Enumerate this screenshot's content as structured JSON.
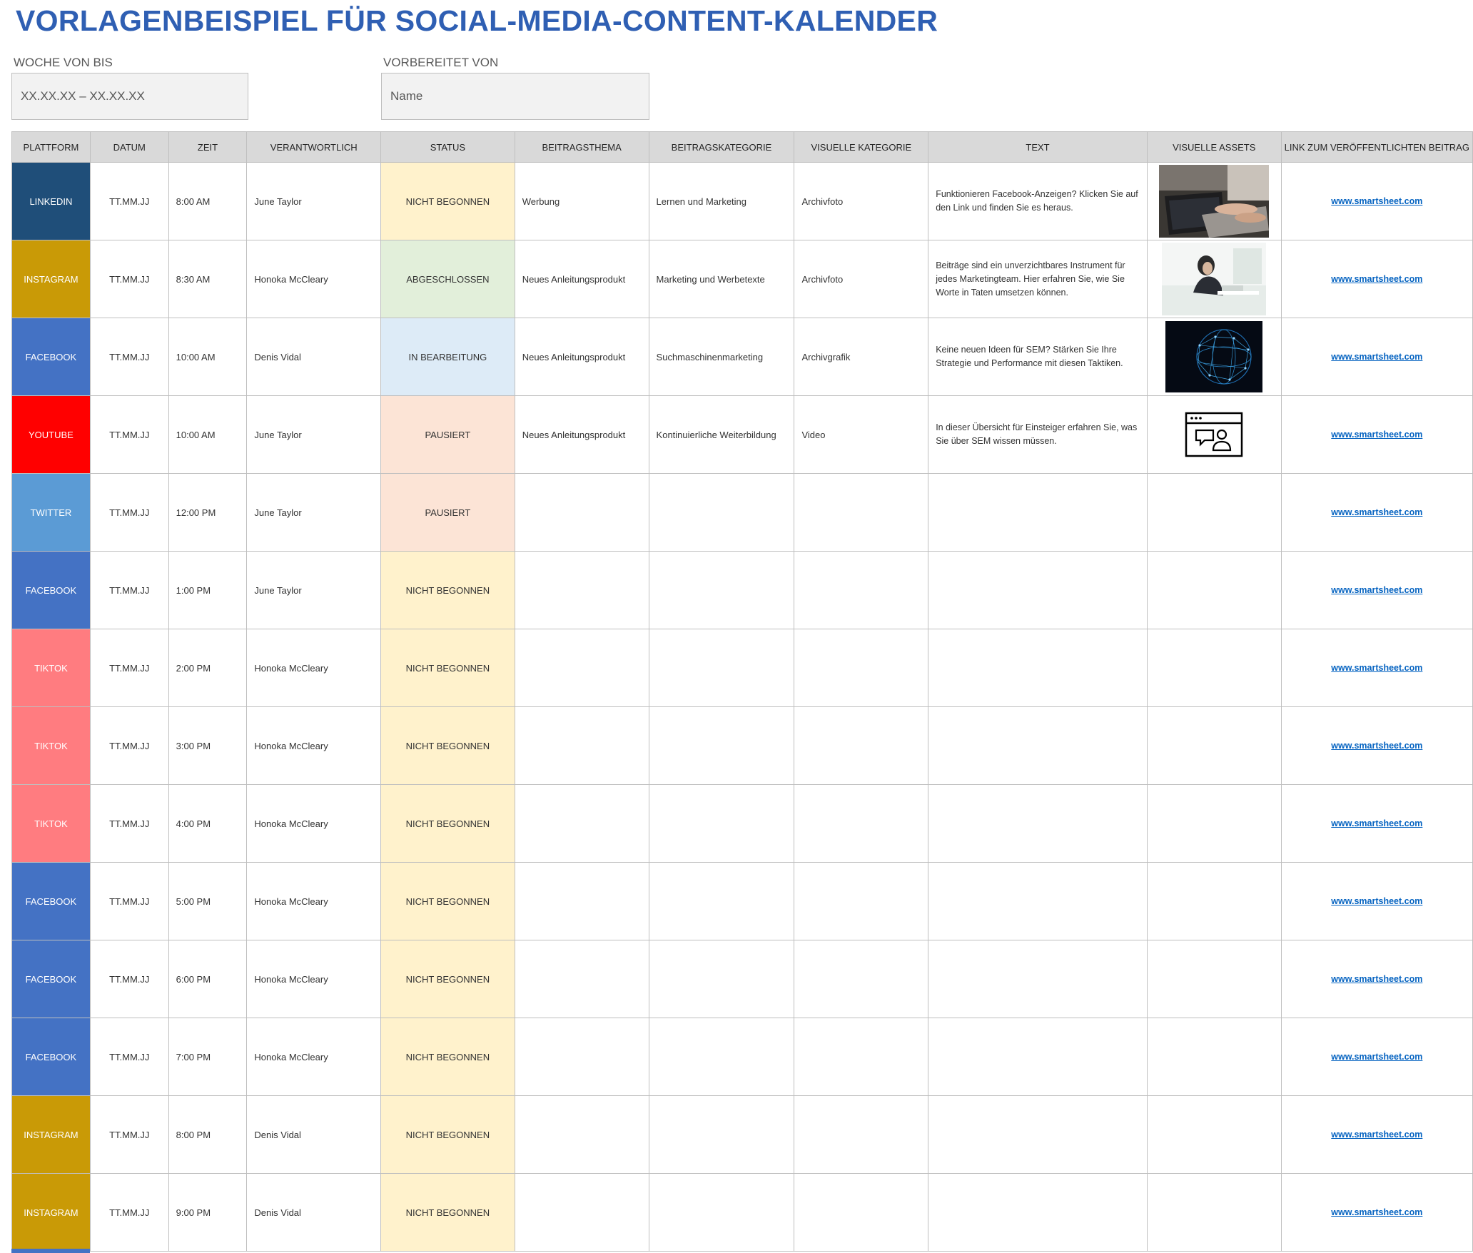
{
  "title": "VORLAGENBEISPIEL FÜR SOCIAL-MEDIA-CONTENT-KALENDER",
  "week": {
    "label": "WOCHE VON BIS",
    "value": "XX.XX.XX – XX.XX.XX"
  },
  "prepared": {
    "label": "VORBEREITET VON",
    "value": "Name"
  },
  "columns": [
    "PLATTFORM",
    "DATUM",
    "ZEIT",
    "VERANTWORTLICH",
    "STATUS",
    "BEITRAGSTHEMA",
    "BEITRAGSKATEGORIE",
    "VISUELLE KATEGORIE",
    "TEXT",
    "VISUELLE ASSETS",
    "LINK ZUM VERÖFFENTLICHTEN BEITRAG"
  ],
  "platform_colors": {
    "LINKEDIN": "#1f4e79",
    "INSTAGRAM": "#c99a06",
    "FACEBOOK": "#4472c4",
    "YOUTUBE": "#ff0000",
    "TWITTER": "#5b9bd5",
    "TIKTOK": "#ff7c80"
  },
  "status_colors": {
    "NICHT BEGONNEN": "#fff2cc",
    "ABGESCHLOSSEN": "#e2efda",
    "IN BEARBEITUNG": "#ddebf7",
    "PAUSIERT": "#fce4d6"
  },
  "rows": [
    {
      "platform": "LINKEDIN",
      "date": "TT.MM.JJ",
      "time": "8:00 AM",
      "owner": "June Taylor",
      "status": "NICHT BEGONNEN",
      "topic": "Werbung",
      "category": "Lernen und Marketing",
      "visual_category": "Archivfoto",
      "text": "Funktionieren Facebook-Anzeigen? Klicken Sie auf den Link und finden Sie es heraus.",
      "asset": "laptop-photo",
      "link": "www.smartsheet.com"
    },
    {
      "platform": "INSTAGRAM",
      "date": "TT.MM.JJ",
      "time": "8:30 AM",
      "owner": "Honoka McCleary",
      "status": "ABGESCHLOSSEN",
      "topic": "Neues Anleitungsprodukt",
      "category": "Marketing und Werbetexte",
      "visual_category": "Archivfoto",
      "text": "Beiträge sind ein unverzichtbares Instrument für jedes Marketingteam. Hier erfahren Sie, wie Sie Worte in Taten umsetzen können.",
      "asset": "woman-desk-photo",
      "link": "www.smartsheet.com"
    },
    {
      "platform": "FACEBOOK",
      "date": "TT.MM.JJ",
      "time": "10:00 AM",
      "owner": "Denis Vidal",
      "status": "IN BEARBEITUNG",
      "topic": "Neues Anleitungsprodukt",
      "category": "Suchmaschinenmarketing",
      "visual_category": "Archivgrafik",
      "text": "Keine neuen Ideen für SEM? Stärken Sie Ihre Strategie und Performance mit diesen Taktiken.",
      "asset": "network-globe-graphic",
      "link": "www.smartsheet.com"
    },
    {
      "platform": "YOUTUBE",
      "date": "TT.MM.JJ",
      "time": "10:00 AM",
      "owner": "June Taylor",
      "status": "PAUSIERT",
      "topic": "Neues Anleitungsprodukt",
      "category": "Kontinuierliche Weiterbildung",
      "visual_category": "Video",
      "text": "In dieser Übersicht für Einsteiger erfahren Sie, was Sie über SEM wissen müssen.",
      "asset": "video-chat-icon",
      "link": "www.smartsheet.com"
    },
    {
      "platform": "TWITTER",
      "date": "TT.MM.JJ",
      "time": "12:00 PM",
      "owner": "June Taylor",
      "status": "PAUSIERT",
      "topic": "",
      "category": "",
      "visual_category": "",
      "text": "",
      "asset": "",
      "link": "www.smartsheet.com"
    },
    {
      "platform": "FACEBOOK",
      "date": "TT.MM.JJ",
      "time": "1:00 PM",
      "owner": "June Taylor",
      "status": "NICHT BEGONNEN",
      "topic": "",
      "category": "",
      "visual_category": "",
      "text": "",
      "asset": "",
      "link": "www.smartsheet.com"
    },
    {
      "platform": "TIKTOK",
      "date": "TT.MM.JJ",
      "time": "2:00 PM",
      "owner": "Honoka McCleary",
      "status": "NICHT BEGONNEN",
      "topic": "",
      "category": "",
      "visual_category": "",
      "text": "",
      "asset": "",
      "link": "www.smartsheet.com"
    },
    {
      "platform": "TIKTOK",
      "date": "TT.MM.JJ",
      "time": "3:00 PM",
      "owner": "Honoka McCleary",
      "status": "NICHT BEGONNEN",
      "topic": "",
      "category": "",
      "visual_category": "",
      "text": "",
      "asset": "",
      "link": "www.smartsheet.com"
    },
    {
      "platform": "TIKTOK",
      "date": "TT.MM.JJ",
      "time": "4:00 PM",
      "owner": "Honoka McCleary",
      "status": "NICHT BEGONNEN",
      "topic": "",
      "category": "",
      "visual_category": "",
      "text": "",
      "asset": "",
      "link": "www.smartsheet.com"
    },
    {
      "platform": "FACEBOOK",
      "date": "TT.MM.JJ",
      "time": "5:00 PM",
      "owner": "Honoka McCleary",
      "status": "NICHT BEGONNEN",
      "topic": "",
      "category": "",
      "visual_category": "",
      "text": "",
      "asset": "",
      "link": "www.smartsheet.com"
    },
    {
      "platform": "FACEBOOK",
      "date": "TT.MM.JJ",
      "time": "6:00 PM",
      "owner": "Honoka McCleary",
      "status": "NICHT BEGONNEN",
      "topic": "",
      "category": "",
      "visual_category": "",
      "text": "",
      "asset": "",
      "link": "www.smartsheet.com"
    },
    {
      "platform": "FACEBOOK",
      "date": "TT.MM.JJ",
      "time": "7:00 PM",
      "owner": "Honoka McCleary",
      "status": "NICHT BEGONNEN",
      "topic": "",
      "category": "",
      "visual_category": "",
      "text": "",
      "asset": "",
      "link": "www.smartsheet.com"
    },
    {
      "platform": "INSTAGRAM",
      "date": "TT.MM.JJ",
      "time": "8:00 PM",
      "owner": "Denis Vidal",
      "status": "NICHT BEGONNEN",
      "topic": "",
      "category": "",
      "visual_category": "",
      "text": "",
      "asset": "",
      "link": "www.smartsheet.com"
    },
    {
      "platform": "INSTAGRAM",
      "date": "TT.MM.JJ",
      "time": "9:00 PM",
      "owner": "Denis Vidal",
      "status": "NICHT BEGONNEN",
      "topic": "",
      "category": "",
      "visual_category": "",
      "text": "",
      "asset": "",
      "link": "www.smartsheet.com"
    }
  ]
}
